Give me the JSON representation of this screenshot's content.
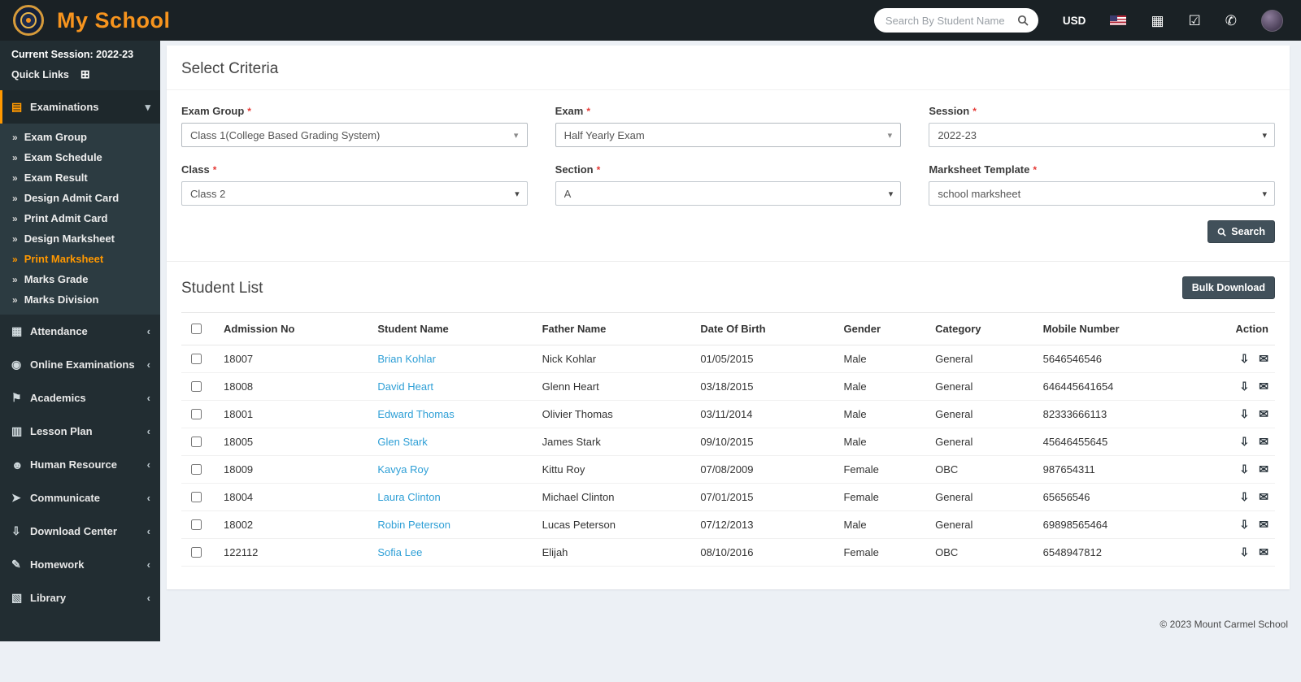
{
  "colors": {
    "accent_orange": "#FF9800",
    "brand_orange": "#F7941E",
    "link_blue": "#2E9FD6",
    "header_bg": "#1A2125",
    "sidebar_bg": "#222D32",
    "submenu_bg": "#2C3B41",
    "active_menu_bg": "#1E282C",
    "content_bg": "#ECF0F5",
    "button_dark": "#41505A",
    "required_red": "#E53935"
  },
  "header": {
    "brand": "My School",
    "search": {
      "placeholder": "Search By Student Name",
      "icon": "search-icon"
    },
    "currency": "USD",
    "icons": [
      {
        "name": "calendar-icon"
      },
      {
        "name": "tasks-icon"
      },
      {
        "name": "whatsapp-icon"
      }
    ],
    "flag_icon": "us-flag-icon",
    "avatar_icon": "user-avatar"
  },
  "sidebar": {
    "session": "Current Session: 2022-23",
    "quick_links": "Quick Links",
    "quick_links_icon": "grid-icon",
    "menus": [
      {
        "label": "Examinations",
        "icon": "exam-icon",
        "active": true,
        "expanded": true,
        "submenu": [
          {
            "label": "Exam Group"
          },
          {
            "label": "Exam Schedule"
          },
          {
            "label": "Exam Result"
          },
          {
            "label": "Design Admit Card"
          },
          {
            "label": "Print Admit Card"
          },
          {
            "label": "Design Marksheet"
          },
          {
            "label": "Print Marksheet",
            "active": true
          },
          {
            "label": "Marks Grade"
          },
          {
            "label": "Marks Division"
          }
        ]
      },
      {
        "label": "Attendance",
        "icon": "attendance-icon"
      },
      {
        "label": "Online Examinations",
        "icon": "online-examinations-icon"
      },
      {
        "label": "Academics",
        "icon": "academics-icon"
      },
      {
        "label": "Lesson Plan",
        "icon": "lesson-plan-icon"
      },
      {
        "label": "Human Resource",
        "icon": "human-resource-icon"
      },
      {
        "label": "Communicate",
        "icon": "communicate-icon"
      },
      {
        "label": "Download Center",
        "icon": "download-center-icon"
      },
      {
        "label": "Homework",
        "icon": "homework-icon"
      },
      {
        "label": "Library",
        "icon": "library-icon"
      }
    ]
  },
  "criteria": {
    "title": "Select Criteria",
    "fields": [
      {
        "label": "Exam Group",
        "required": true,
        "value": "Class 1(College Based Grading System)",
        "style": "select2"
      },
      {
        "label": "Exam",
        "required": true,
        "value": "Half Yearly Exam",
        "style": "select2"
      },
      {
        "label": "Session",
        "required": true,
        "value": "2022-23",
        "style": "native"
      },
      {
        "label": "Class",
        "required": true,
        "value": "Class 2",
        "style": "native"
      },
      {
        "label": "Section",
        "required": true,
        "value": "A",
        "style": "native"
      },
      {
        "label": "Marksheet Template",
        "required": true,
        "value": "school marksheet",
        "style": "native"
      }
    ],
    "search_button": "Search"
  },
  "student_list": {
    "title": "Student List",
    "bulk_download_button": "Bulk Download",
    "columns": [
      "Admission No",
      "Student Name",
      "Father Name",
      "Date Of Birth",
      "Gender",
      "Category",
      "Mobile Number",
      "Action"
    ],
    "row_actions": [
      {
        "icon": "download-icon"
      },
      {
        "icon": "email-icon"
      }
    ],
    "rows": [
      {
        "admission_no": "18007",
        "student_name": "Brian Kohlar",
        "father_name": "Nick Kohlar",
        "date_of_birth": "01/05/2015",
        "gender": "Male",
        "category": "General",
        "mobile_number": "5646546546"
      },
      {
        "admission_no": "18008",
        "student_name": "David Heart",
        "father_name": "Glenn Heart",
        "date_of_birth": "03/18/2015",
        "gender": "Male",
        "category": "General",
        "mobile_number": "646445641654"
      },
      {
        "admission_no": "18001",
        "student_name": "Edward Thomas",
        "father_name": "Olivier Thomas",
        "date_of_birth": "03/11/2014",
        "gender": "Male",
        "category": "General",
        "mobile_number": "82333666113"
      },
      {
        "admission_no": "18005",
        "student_name": "Glen Stark",
        "father_name": "James Stark",
        "date_of_birth": "09/10/2015",
        "gender": "Male",
        "category": "General",
        "mobile_number": "45646455645"
      },
      {
        "admission_no": "18009",
        "student_name": "Kavya Roy",
        "father_name": "Kittu Roy",
        "date_of_birth": "07/08/2009",
        "gender": "Female",
        "category": "OBC",
        "mobile_number": "987654311"
      },
      {
        "admission_no": "18004",
        "student_name": "Laura Clinton",
        "father_name": "Michael Clinton",
        "date_of_birth": "07/01/2015",
        "gender": "Female",
        "category": "General",
        "mobile_number": "65656546"
      },
      {
        "admission_no": "18002",
        "student_name": "Robin Peterson",
        "father_name": "Lucas Peterson",
        "date_of_birth": "07/12/2013",
        "gender": "Male",
        "category": "General",
        "mobile_number": "69898565464"
      },
      {
        "admission_no": "122112",
        "student_name": "Sofia Lee",
        "father_name": "Elijah",
        "date_of_birth": "08/10/2016",
        "gender": "Female",
        "category": "OBC",
        "mobile_number": "6548947812"
      }
    ]
  },
  "footer": {
    "copyright": "© 2023 Mount Carmel School"
  }
}
